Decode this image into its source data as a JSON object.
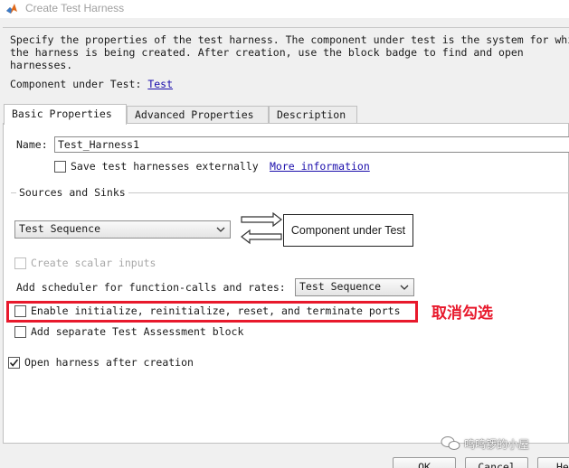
{
  "window": {
    "title": "Create Test Harness",
    "icon": "matlab-logo-icon"
  },
  "description": {
    "text": "Specify the properties of the test harness. The component under test is the system for which\nthe harness is being created. After creation, use the block badge to find and open\nharnesses.",
    "cut_label": "Component under Test: ",
    "cut_link": "Test"
  },
  "tabs": [
    {
      "label": "Basic Properties",
      "active": true
    },
    {
      "label": "Advanced Properties",
      "active": false
    },
    {
      "label": "Description",
      "active": false
    }
  ],
  "basic": {
    "name_label": "Name:",
    "name_value": "Test_Harness1",
    "save_externally_label": "Save test harnesses externally",
    "save_externally_checked": false,
    "more_info_link": "More information",
    "sources_sinks": {
      "title": "Sources and Sinks",
      "source_value": "Test Sequence",
      "cut_diagram_label": "Component under Test",
      "create_scalar_label": "Create scalar inputs",
      "create_scalar_enabled": false,
      "scheduler_label": "Add scheduler for function-calls and rates:",
      "scheduler_value": "Test Sequence",
      "enable_init_label": "Enable initialize, reinitialize, reset, and terminate ports",
      "enable_init_checked": false,
      "add_assessment_label": "Add separate Test Assessment block",
      "add_assessment_checked": false
    },
    "open_after_label": "Open harness after creation",
    "open_after_checked": true
  },
  "annotation": {
    "text": "取消勾选",
    "color": "#e8192c"
  },
  "watermark": {
    "text": "呜呜锣的小屋"
  },
  "buttons": {
    "ok": "OK",
    "cancel": "Cancel",
    "help": "He"
  }
}
